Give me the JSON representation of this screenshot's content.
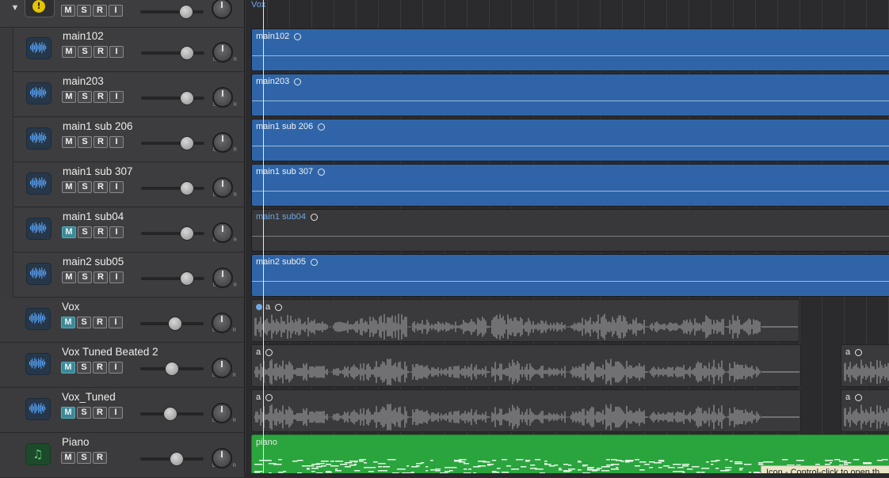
{
  "group": {
    "buttons": [
      "M",
      "S",
      "R",
      "I"
    ],
    "volume": 0.72
  },
  "tracks": [
    {
      "name": "main102",
      "buttons": [
        "M",
        "S",
        "R",
        "I"
      ],
      "mute_on": false,
      "volume": 0.72
    },
    {
      "name": "main203",
      "buttons": [
        "M",
        "S",
        "R",
        "I"
      ],
      "mute_on": false,
      "volume": 0.72
    },
    {
      "name": "main1 sub 206",
      "buttons": [
        "M",
        "S",
        "R",
        "I"
      ],
      "mute_on": false,
      "volume": 0.72
    },
    {
      "name": "main1 sub 307",
      "buttons": [
        "M",
        "S",
        "R",
        "I"
      ],
      "mute_on": false,
      "volume": 0.72
    },
    {
      "name": "main1 sub04",
      "buttons": [
        "M",
        "S",
        "R",
        "I"
      ],
      "mute_on": true,
      "volume": 0.72
    },
    {
      "name": "main2 sub05",
      "buttons": [
        "M",
        "S",
        "R",
        "I"
      ],
      "mute_on": false,
      "volume": 0.72
    },
    {
      "name": "Vox",
      "buttons": [
        "M",
        "S",
        "R",
        "I"
      ],
      "mute_on": true,
      "volume": 0.55
    },
    {
      "name": "Vox Tuned Beated 2",
      "buttons": [
        "M",
        "S",
        "R",
        "I"
      ],
      "mute_on": true,
      "volume": 0.5
    },
    {
      "name": "Vox_Tuned",
      "buttons": [
        "M",
        "S",
        "R",
        "I"
      ],
      "mute_on": true,
      "volume": 0.47
    },
    {
      "name": "Piano",
      "buttons": [
        "M",
        "S",
        "R"
      ],
      "mute_on": false,
      "volume": 0.57
    }
  ],
  "pan_labels": {
    "left": "L",
    "right": "R"
  },
  "arrange": {
    "folder_label": "Vox",
    "regions": {
      "main102": "main102",
      "main203": "main203",
      "main1_sub_206": "main1 sub 206",
      "main1_sub_307": "main1 sub 307",
      "main1_sub04": "main1 sub04",
      "main2_sub05": "main2 sub05",
      "vox": "a",
      "vox_tuned_beated": "a",
      "vox_tuned_beated_b": "a",
      "vox_tuned": "a",
      "vox_tuned_b": "a",
      "piano": "piano"
    }
  },
  "tooltip": "Icon - Control-click to open th"
}
